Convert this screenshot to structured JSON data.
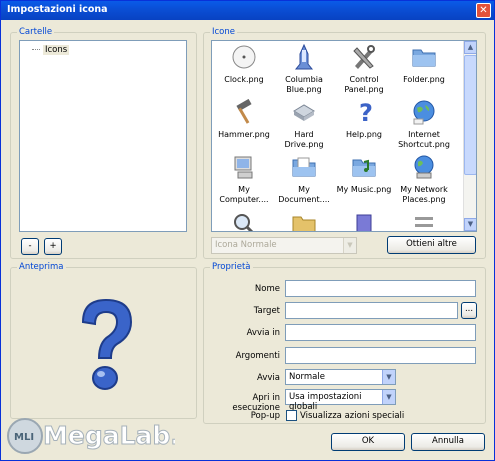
{
  "window": {
    "title": "Impostazioni icona"
  },
  "folders": {
    "legend": "Cartelle",
    "items": [
      "Icons"
    ],
    "remove_label": "-",
    "add_label": "+"
  },
  "icons": {
    "legend": "Icone",
    "items": [
      {
        "label": "Clock.png",
        "icon": "clock-icon"
      },
      {
        "label": "Columbia Blue.png",
        "icon": "shuttle-icon"
      },
      {
        "label": "Control Panel.png",
        "icon": "tools-icon"
      },
      {
        "label": "Folder.png",
        "icon": "folder-icon"
      },
      {
        "label": "Hammer.png",
        "icon": "hammer-icon"
      },
      {
        "label": "Hard Drive.png",
        "icon": "hard-drive-icon"
      },
      {
        "label": "Help.png",
        "icon": "help-icon"
      },
      {
        "label": "Internet Shortcut.png",
        "icon": "globe-icon"
      },
      {
        "label": "My Computer....",
        "icon": "computer-icon"
      },
      {
        "label": "My Document....",
        "icon": "documents-folder-icon"
      },
      {
        "label": "My Music.png",
        "icon": "music-folder-icon"
      },
      {
        "label": "My Network Places.png",
        "icon": "network-globe-icon"
      }
    ],
    "size_select": "Icona Normale",
    "get_more_label": "Ottieni altre"
  },
  "preview": {
    "legend": "Anteprima"
  },
  "properties": {
    "legend": "Proprietà",
    "name_label": "Nome",
    "target_label": "Target",
    "target_browse": "...",
    "start_in_label": "Avvia in",
    "arguments_label": "Argomenti",
    "start_label": "Avvia",
    "start_value": "Normale",
    "run_as_label": "Apri in esecuzione",
    "run_as_value": "Usa impostazioni globali",
    "popup_label": "Pop-up",
    "popup_checkbox_label": "Visualizza azioni speciali"
  },
  "footer": {
    "ok_label": "OK",
    "cancel_label": "Annulla"
  },
  "watermark": {
    "text": "MegaLab.it",
    "badge": "MLI"
  }
}
